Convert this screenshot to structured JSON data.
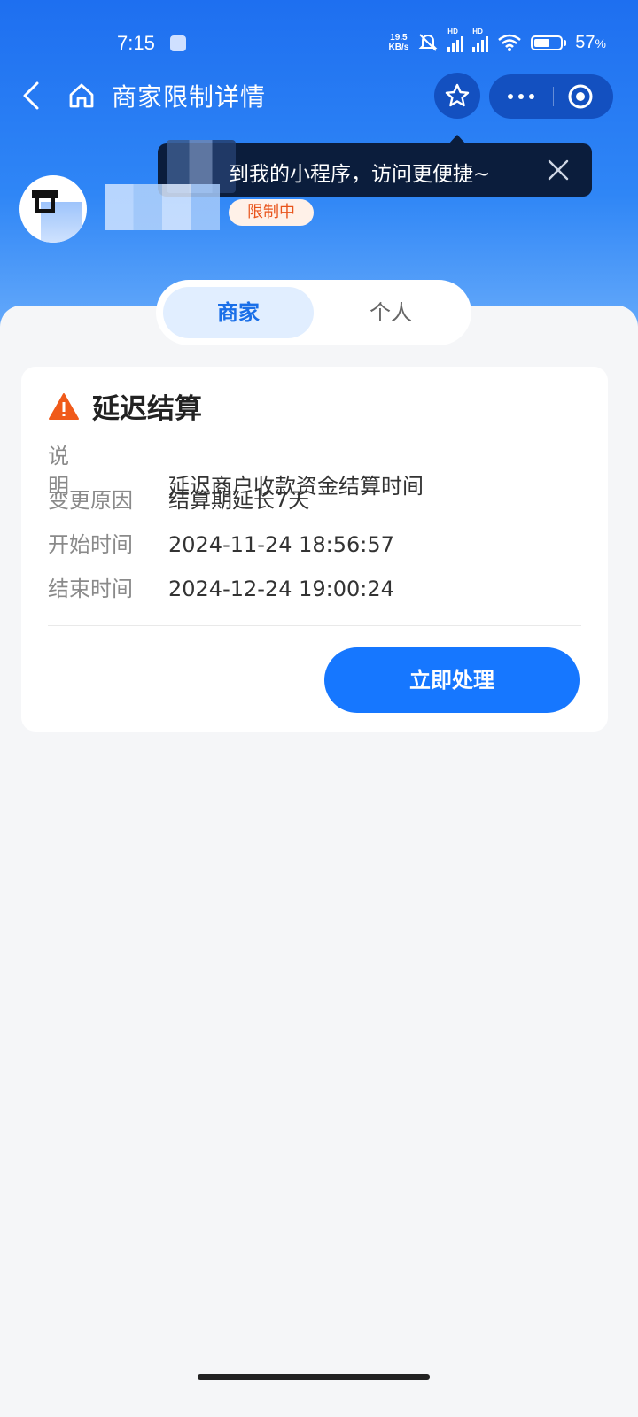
{
  "status_bar": {
    "time": "7:15",
    "net_speed_value": "19.5",
    "net_speed_unit": "KB/s",
    "battery": "57",
    "battery_unit": "%",
    "hd1": "HD",
    "hd2": "HD"
  },
  "nav": {
    "title": "商家限制详情"
  },
  "tooltip": {
    "text": "到我的小程序，访问更便捷~"
  },
  "merchant": {
    "status_badge": "限制中"
  },
  "tabs": [
    {
      "label": "商家"
    },
    {
      "label": "个人"
    }
  ],
  "card": {
    "title": "延迟结算",
    "rows": [
      {
        "label": "说明",
        "value": "延迟商户收款资金结算时间"
      },
      {
        "label": "变更原因",
        "value": "结算期延长7天"
      },
      {
        "label": "开始时间",
        "value": "2024-11-24 18:56:57"
      },
      {
        "label": "结束时间",
        "value": "2024-12-24 19:00:24"
      }
    ],
    "action_label": "立即处理"
  },
  "colors": {
    "primary": "#1677ff",
    "warning": "#f05a1a",
    "badge_text": "#e8541b"
  }
}
